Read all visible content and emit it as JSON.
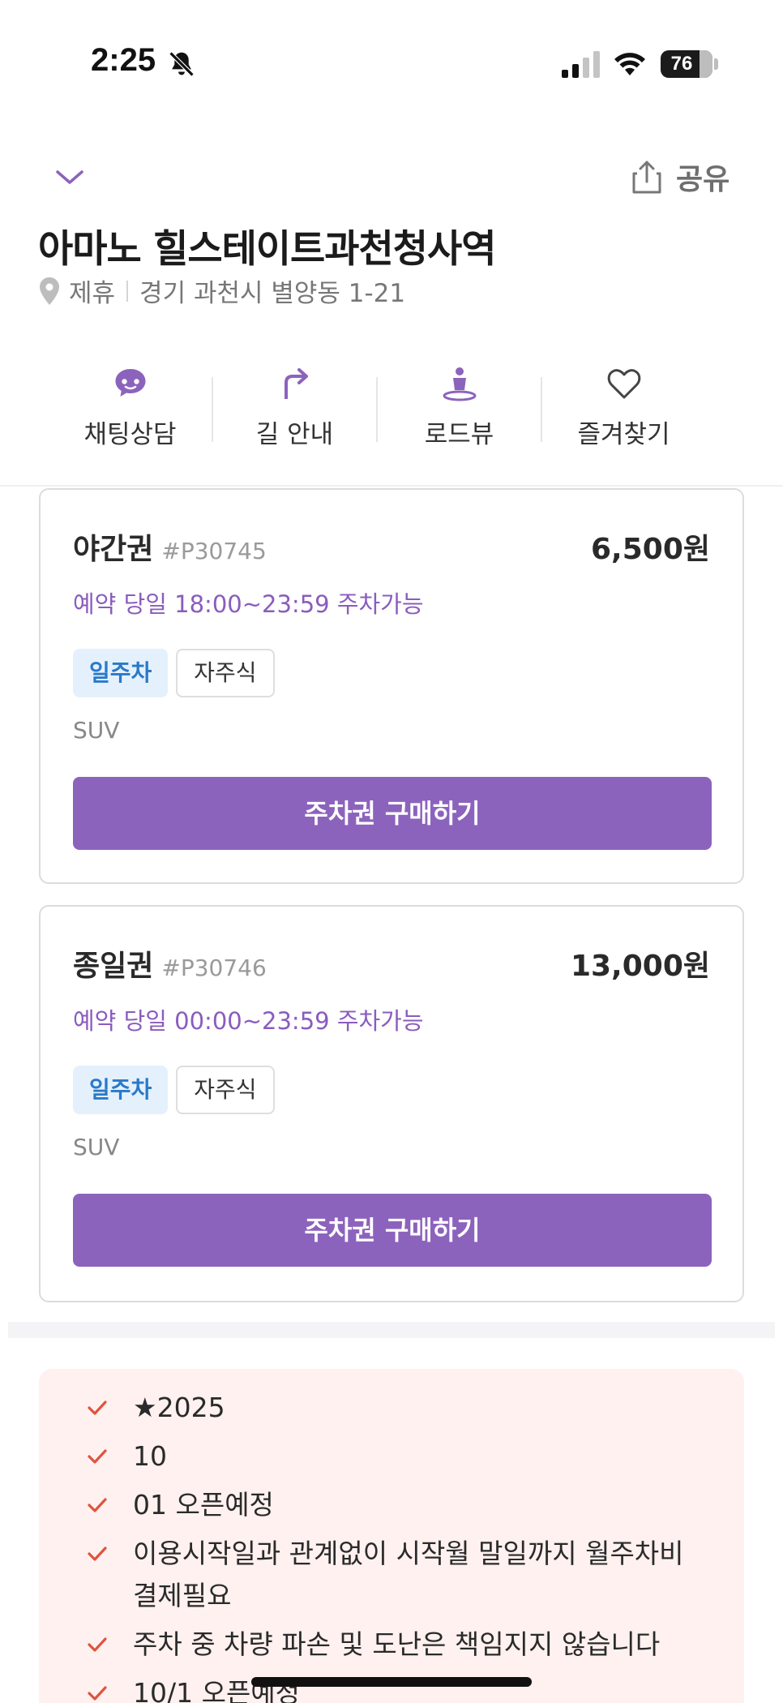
{
  "status_bar": {
    "time": "2:25",
    "battery": "76"
  },
  "header": {
    "share_label": "공유",
    "title": "아마노 힐스테이트과천청사역",
    "tag": "제휴",
    "address": "경기 과천시 별양동 1-21"
  },
  "actions": [
    {
      "label": "채팅상담",
      "icon": "chat-icon"
    },
    {
      "label": "길 안내",
      "icon": "directions-icon"
    },
    {
      "label": "로드뷰",
      "icon": "roadview-icon"
    },
    {
      "label": "즐겨찾기",
      "icon": "heart-icon"
    }
  ],
  "tickets": [
    {
      "name": "야간권",
      "code": "#P30745",
      "price": "6,500원",
      "availability": "예약 당일 18:00~23:59 주차가능",
      "tags": [
        "일주차",
        "자주식"
      ],
      "vehicle": "SUV",
      "buy_label": "주차권 구매하기"
    },
    {
      "name": "종일권",
      "code": "#P30746",
      "price": "13,000원",
      "availability": "예약 당일 00:00~23:59 주차가능",
      "tags": [
        "일주차",
        "자주식"
      ],
      "vehicle": "SUV",
      "buy_label": "주차권 구매하기"
    }
  ],
  "notice": [
    "★2025",
    "10",
    "01 오픈예정",
    "이용시작일과 관계없이 시작월 말일까지 월주차비 결제필요",
    "주차 중 차량 파손 및 도난은 책임지지 않습니다",
    "10/1 오픈예정"
  ],
  "colors": {
    "accent": "#8c63bc",
    "tag_blue": "#2a79c9",
    "check_red": "#e0533f"
  }
}
